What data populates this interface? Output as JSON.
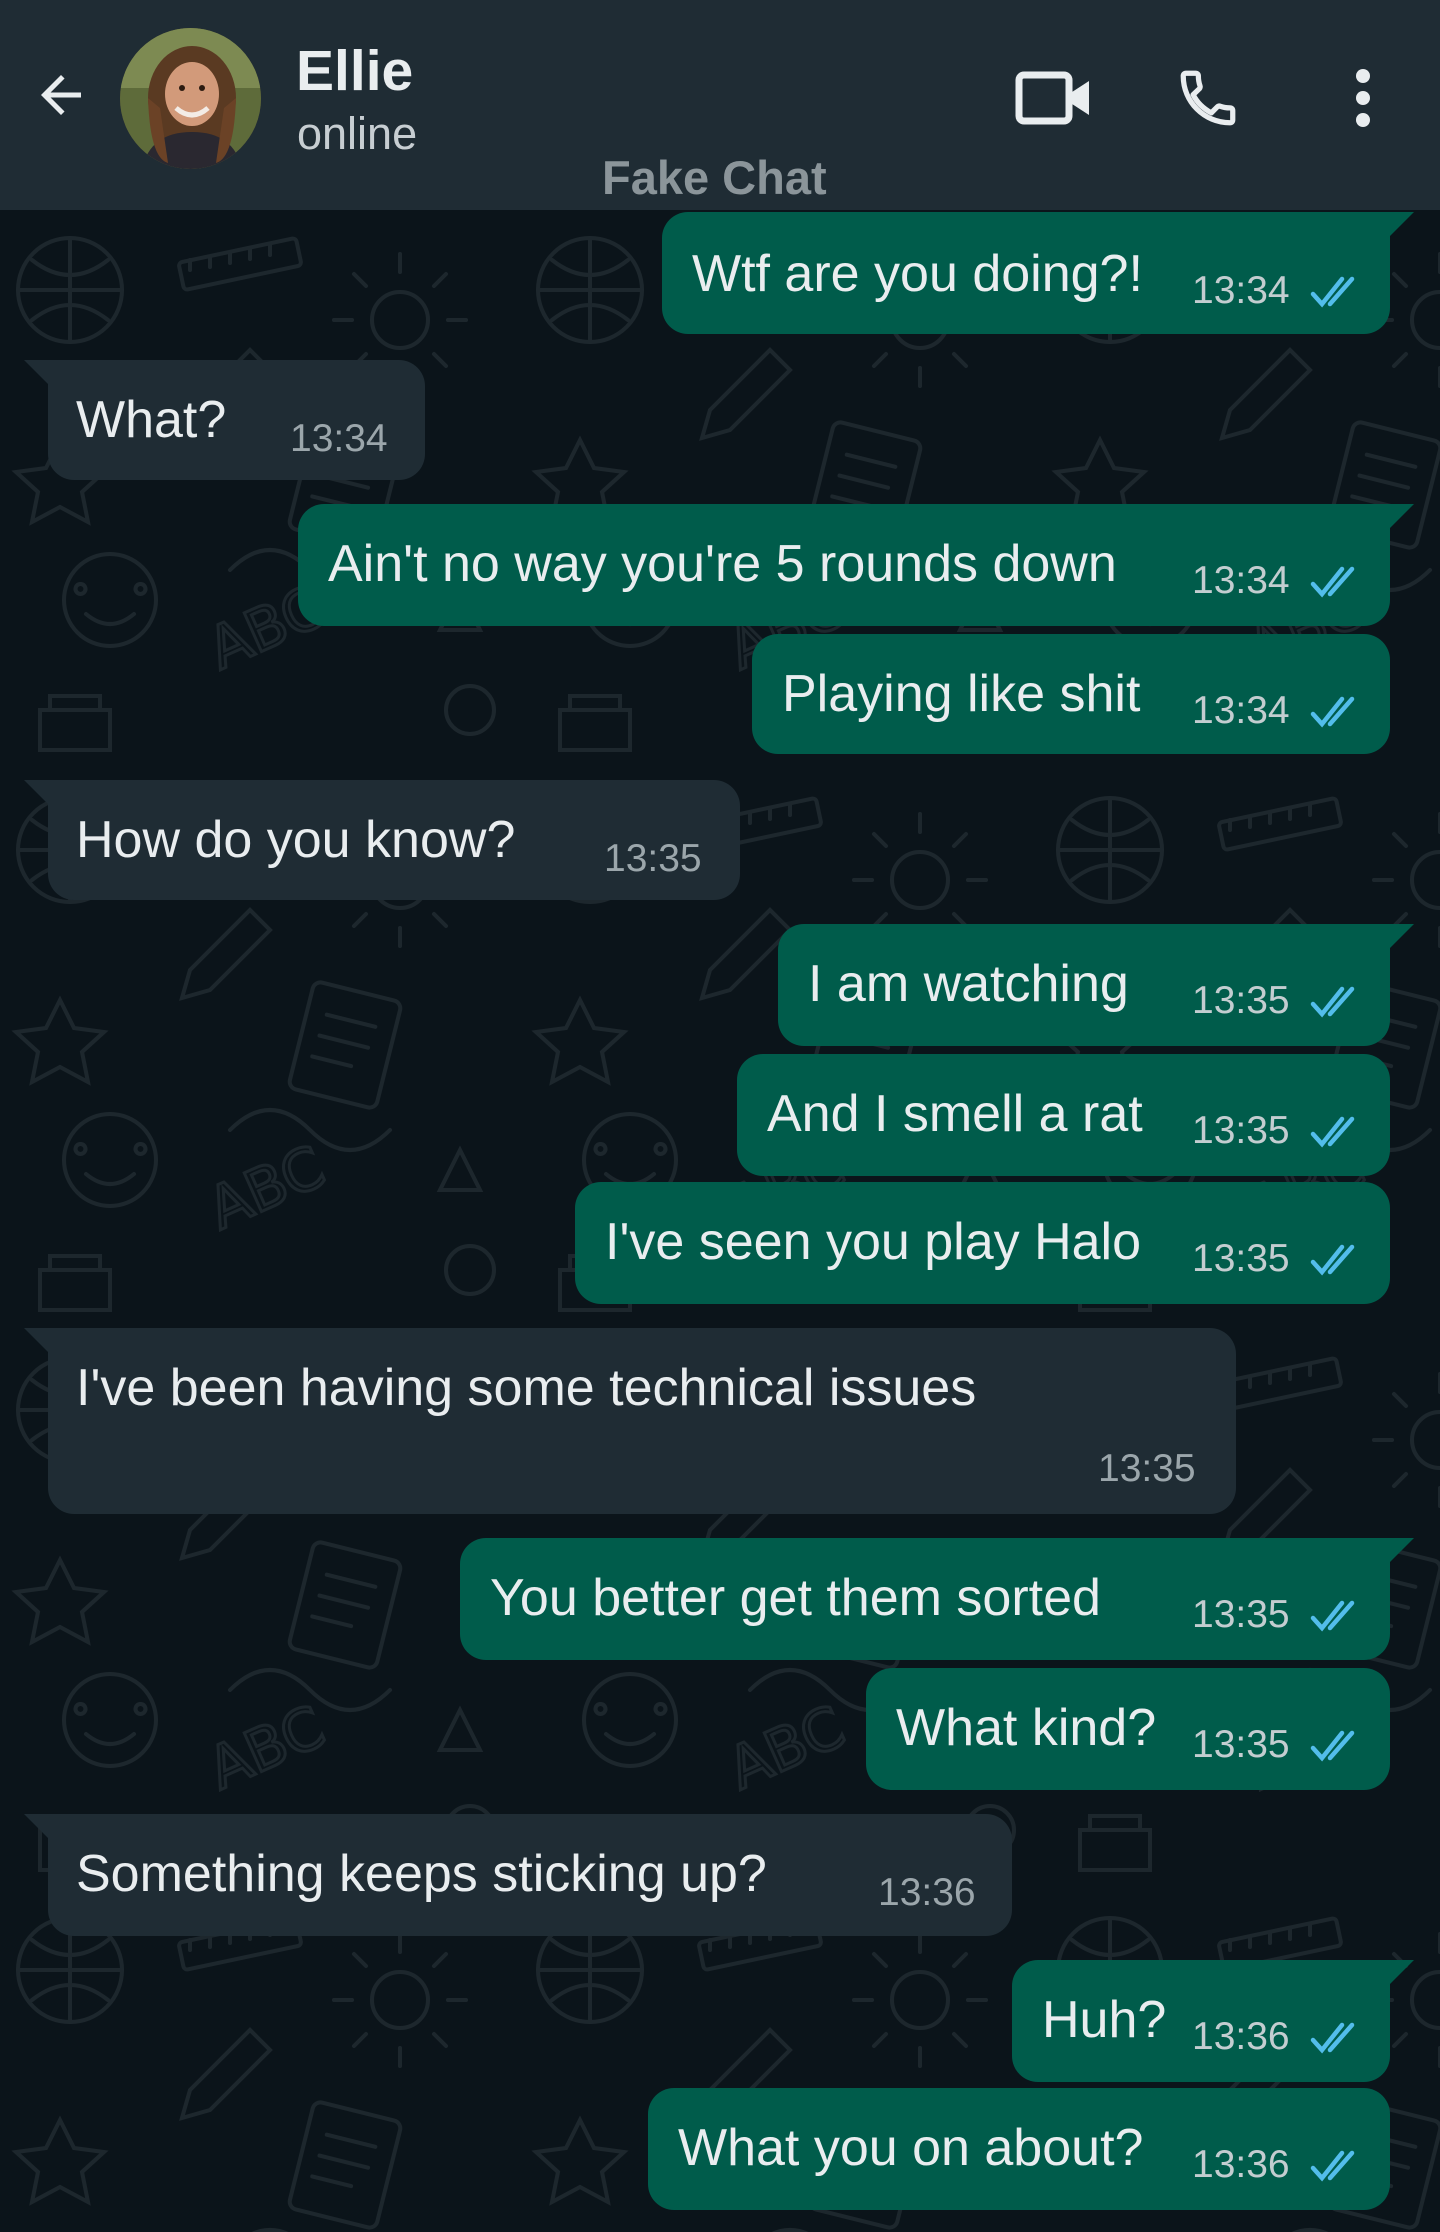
{
  "header": {
    "contact_name": "Ellie",
    "status": "online",
    "watermark": "Fake Chat",
    "icons": [
      "back-arrow-icon",
      "avatar-photo",
      "video-camera-icon",
      "phone-icon",
      "more-vertical-icon"
    ]
  },
  "colors": {
    "header_bg": "#1f2c34",
    "chat_bg": "#0b141a",
    "outgoing_bubble": "#005c4b",
    "incoming_bubble": "#1f2c34",
    "read_ticks": "#53bdeb",
    "text": "#e9edef"
  },
  "messages": [
    {
      "direction": "out",
      "text": "Wtf are you doing?!",
      "time": "13:34",
      "status": "read"
    },
    {
      "direction": "in",
      "text": "What?",
      "time": "13:34"
    },
    {
      "direction": "out",
      "text": "Ain't no way you're 5 rounds down",
      "time": "13:34",
      "status": "read"
    },
    {
      "direction": "out",
      "text": "Playing like shit",
      "time": "13:34",
      "status": "read"
    },
    {
      "direction": "in",
      "text": "How do you know?",
      "time": "13:35"
    },
    {
      "direction": "out",
      "text": "I am watching",
      "time": "13:35",
      "status": "read"
    },
    {
      "direction": "out",
      "text": "And I smell a rat",
      "time": "13:35",
      "status": "read"
    },
    {
      "direction": "out",
      "text": "I've seen you play Halo",
      "time": "13:35",
      "status": "read"
    },
    {
      "direction": "in",
      "text": "I've been having some technical issues",
      "time": "13:35"
    },
    {
      "direction": "out",
      "text": "You better get them sorted",
      "time": "13:35",
      "status": "read"
    },
    {
      "direction": "out",
      "text": "What kind?",
      "time": "13:35",
      "status": "read"
    },
    {
      "direction": "in",
      "text": "Something keeps sticking up?",
      "time": "13:36"
    },
    {
      "direction": "out",
      "text": "Huh?",
      "time": "13:36",
      "status": "read"
    },
    {
      "direction": "out",
      "text": "What you on about?",
      "time": "13:36",
      "status": "read"
    }
  ]
}
